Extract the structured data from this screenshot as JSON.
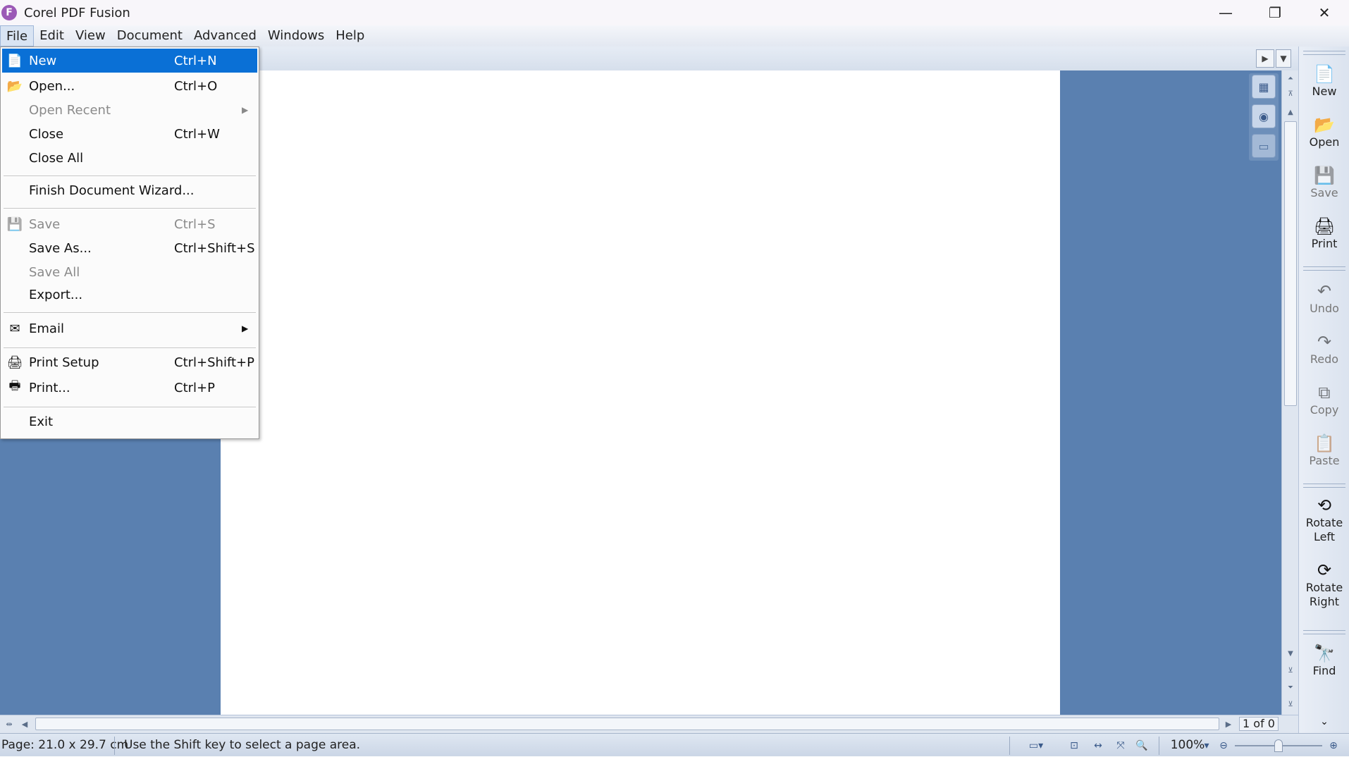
{
  "window": {
    "title": "Corel PDF Fusion",
    "app_icon_glyph": "F",
    "controls": {
      "minimize": "—",
      "restore": "❐",
      "close": "✕"
    }
  },
  "menubar": {
    "items": [
      "File",
      "Edit",
      "View",
      "Document",
      "Advanced",
      "Windows",
      "Help"
    ]
  },
  "file_menu": {
    "items": [
      {
        "label": "New",
        "shortcut": "Ctrl+N",
        "icon": "new-document-icon"
      },
      {
        "label": "Open...",
        "shortcut": "Ctrl+O",
        "icon": "open-folder-icon"
      },
      {
        "label": "Open Recent",
        "shortcut": "",
        "icon": ""
      },
      {
        "label": "Close",
        "shortcut": "Ctrl+W",
        "icon": ""
      },
      {
        "label": "Close All",
        "shortcut": "",
        "icon": ""
      },
      {
        "label": "Finish Document Wizard...",
        "shortcut": "",
        "icon": ""
      },
      {
        "label": "Save",
        "shortcut": "Ctrl+S",
        "icon": "save-icon"
      },
      {
        "label": "Save As...",
        "shortcut": "Ctrl+Shift+S",
        "icon": ""
      },
      {
        "label": "Save All",
        "shortcut": "",
        "icon": ""
      },
      {
        "label": "Export...",
        "shortcut": "",
        "icon": ""
      },
      {
        "label": "Email",
        "shortcut": "",
        "icon": "email-icon"
      },
      {
        "label": "Print Setup",
        "shortcut": "Ctrl+Shift+P",
        "icon": "print-setup-icon"
      },
      {
        "label": "Print...",
        "shortcut": "Ctrl+P",
        "icon": "printer-icon"
      },
      {
        "label": "Exit",
        "shortcut": "",
        "icon": ""
      }
    ]
  },
  "right_toolbar": {
    "buttons": [
      {
        "label": "New",
        "icon": "new-document-icon",
        "enabled": true
      },
      {
        "label": "Open",
        "icon": "open-folder-icon",
        "enabled": true
      },
      {
        "label": "Save",
        "icon": "save-icon",
        "enabled": false
      },
      {
        "label": "Print",
        "icon": "printer-icon",
        "enabled": true
      },
      {
        "label": "Undo",
        "icon": "undo-icon",
        "enabled": false
      },
      {
        "label": "Redo",
        "icon": "redo-icon",
        "enabled": false
      },
      {
        "label": "Copy",
        "icon": "copy-icon",
        "enabled": false
      },
      {
        "label": "Paste",
        "icon": "paste-icon",
        "enabled": false
      },
      {
        "label": "Rotate Left",
        "label_line1": "Rotate",
        "label_line2": "Left",
        "icon": "rotate-left-icon",
        "enabled": true
      },
      {
        "label": "Rotate Right",
        "label_line1": "Rotate",
        "label_line2": "Right",
        "icon": "rotate-right-icon",
        "enabled": true
      },
      {
        "label": "Find",
        "icon": "binoculars-icon",
        "enabled": true
      }
    ]
  },
  "scroll": {
    "page_indicator": "1 of 0"
  },
  "statusbar": {
    "page_size": "Page: 21.0 x 29.7 cm",
    "hint": "Use the Shift key to select a page area.",
    "zoom": "100%"
  },
  "colors": {
    "workspace": "#5a80b0",
    "menu_highlight": "#0a70d6",
    "page": "#ffffff"
  }
}
